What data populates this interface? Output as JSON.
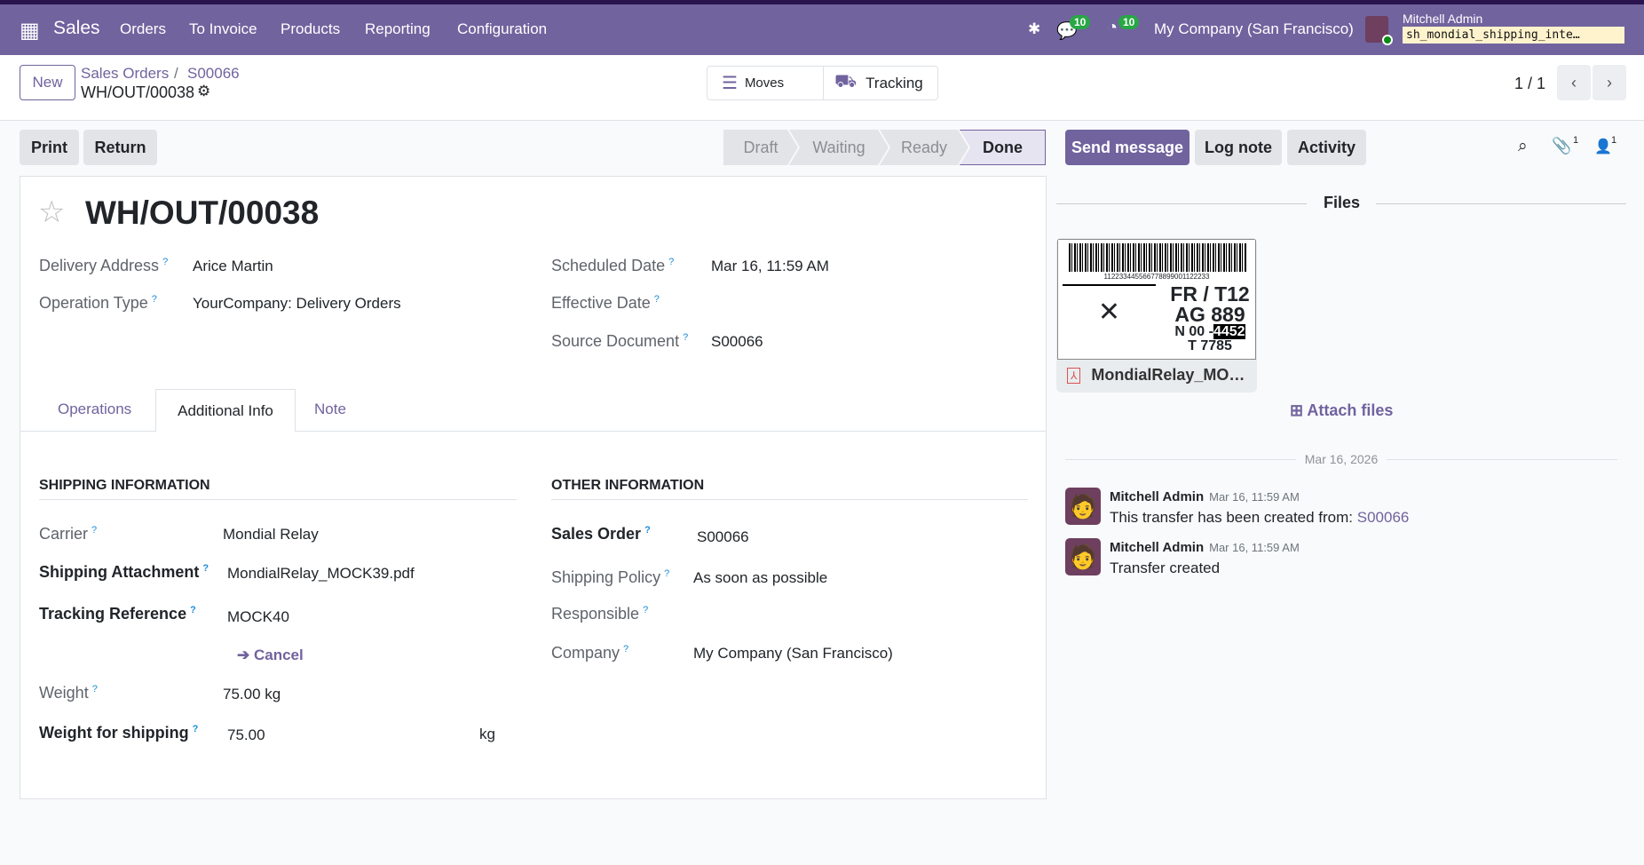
{
  "navbar": {
    "app": "Sales",
    "menu": [
      "Orders",
      "To Invoice",
      "Products",
      "Reporting",
      "Configuration"
    ],
    "messages_count": "10",
    "activities_count": "10",
    "company": "My Company (San Francisco)",
    "user": "Mitchell Admin",
    "database": "sh_mondial_shipping_inte…"
  },
  "control": {
    "new": "New",
    "breadcrumb": [
      "Sales Orders",
      "S00066"
    ],
    "record": "WH/OUT/00038",
    "moves": "Moves",
    "tracking": "Tracking",
    "pager": "1 / 1"
  },
  "actions": {
    "print": "Print",
    "return": "Return",
    "statuses": [
      "Draft",
      "Waiting",
      "Ready",
      "Done"
    ],
    "current_status": "Done"
  },
  "chatter_actions": {
    "send": "Send message",
    "log": "Log note",
    "activity": "Activity",
    "attachments_count": "1",
    "followers_count": "1"
  },
  "form": {
    "title": "WH/OUT/00038",
    "left": [
      {
        "label": "Delivery Address",
        "value": "Arice Martin"
      },
      {
        "label": "Operation Type",
        "value": "YourCompany: Delivery Orders"
      }
    ],
    "right": [
      {
        "label": "Scheduled Date",
        "value": "Mar 16, 11:59 AM"
      },
      {
        "label": "Effective Date",
        "value": ""
      },
      {
        "label": "Source Document",
        "value": "S00066"
      }
    ],
    "tabs": [
      "Operations",
      "Additional Info",
      "Note"
    ],
    "shipping": {
      "heading": "SHIPPING INFORMATION",
      "carrier_label": "Carrier",
      "carrier": "Mondial Relay",
      "attachment_label": "Shipping Attachment",
      "attachment": "MondialRelay_MOCK39.pdf",
      "tracking_label": "Tracking Reference",
      "tracking": "MOCK40",
      "cancel": "Cancel",
      "weight_label": "Weight",
      "weight": "75.00 kg",
      "wfs_label": "Weight for shipping",
      "wfs": "75.00",
      "wfs_unit": "kg"
    },
    "other": {
      "heading": "OTHER INFORMATION",
      "so_label": "Sales Order",
      "so": "S00066",
      "policy_label": "Shipping Policy",
      "policy": "As soon as possible",
      "responsible_label": "Responsible",
      "company_label": "Company",
      "company": "My Company (San Francisco)"
    }
  },
  "chatter": {
    "files": "Files",
    "file_name": "MondialRelay_MO…",
    "label_lines": [
      "FR / T12",
      "AG 889",
      "N 00 -",
      "4452",
      "T 7785"
    ],
    "barcode": "112233445566778899001122233",
    "attach": "Attach files",
    "date": "Mar 16, 2026",
    "messages": [
      {
        "author": "Mitchell Admin",
        "time": "Mar 16, 11:59 AM",
        "text": "This transfer has been created from: ",
        "link": "S00066"
      },
      {
        "author": "Mitchell Admin",
        "time": "Mar 16, 11:59 AM",
        "text": "Transfer created"
      }
    ]
  },
  "colors": {
    "brand": "#71639e",
    "badge": "#28a745"
  }
}
